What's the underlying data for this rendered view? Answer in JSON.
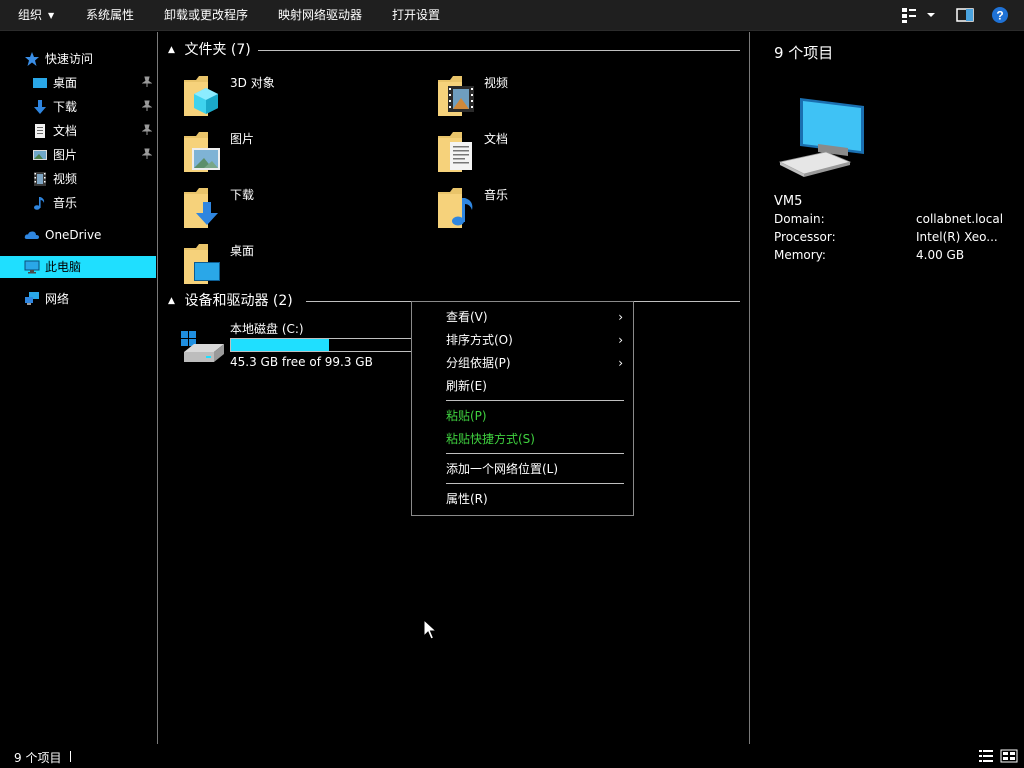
{
  "toolbar": {
    "organize": "组织",
    "system_properties": "系统属性",
    "uninstall": "卸载或更改程序",
    "map_drive": "映射网络驱动器",
    "open_settings": "打开设置"
  },
  "nav": {
    "quick_access": "快速访问",
    "items": [
      {
        "label": "桌面",
        "icon": "desktop-icon",
        "pinned": true
      },
      {
        "label": "下载",
        "icon": "download-icon",
        "pinned": true
      },
      {
        "label": "文档",
        "icon": "document-icon",
        "pinned": true
      },
      {
        "label": "图片",
        "icon": "picture-icon",
        "pinned": true
      },
      {
        "label": "视频",
        "icon": "video-icon",
        "pinned": false
      },
      {
        "label": "音乐",
        "icon": "music-icon",
        "pinned": false
      }
    ],
    "onedrive": "OneDrive",
    "this_pc": "此电脑",
    "network": "网络"
  },
  "content": {
    "folders_header": "文件夹 (7)",
    "folders": [
      {
        "label": "3D 对象",
        "icon": "3d-objects-folder-icon"
      },
      {
        "label": "视频",
        "icon": "videos-folder-icon"
      },
      {
        "label": "图片",
        "icon": "pictures-folder-icon"
      },
      {
        "label": "文档",
        "icon": "documents-folder-icon"
      },
      {
        "label": "下载",
        "icon": "downloads-folder-icon"
      },
      {
        "label": "音乐",
        "icon": "music-folder-icon"
      },
      {
        "label": "桌面",
        "icon": "desktop-folder-icon"
      }
    ],
    "devices_header": "设备和驱动器 (2)",
    "drive": {
      "name": "本地磁盘 (C:)",
      "free_text": "45.3 GB free of 99.3 GB",
      "used_fraction": 0.544
    }
  },
  "details": {
    "title": "9 个项目",
    "computer_name": "VM5",
    "rows": [
      {
        "key": "Domain:",
        "value": "collabnet.local"
      },
      {
        "key": "Processor:",
        "value": "Intel(R) Xeo..."
      },
      {
        "key": "Memory:",
        "value": "4.00 GB"
      }
    ]
  },
  "status": {
    "count": "9 个项目"
  },
  "context_menu": {
    "view": "查看(V)",
    "sort": "排序方式(O)",
    "group": "分组依据(P)",
    "refresh": "刷新(E)",
    "paste": "粘贴(P)",
    "paste_shortcut": "粘贴快捷方式(S)",
    "add_network_location": "添加一个网络位置(L)",
    "properties": "属性(R)",
    "submenu_arrow": "›"
  },
  "colors": {
    "accent": "#1fdfff",
    "disabled_text": "#3fd13f",
    "background": "#000000"
  }
}
